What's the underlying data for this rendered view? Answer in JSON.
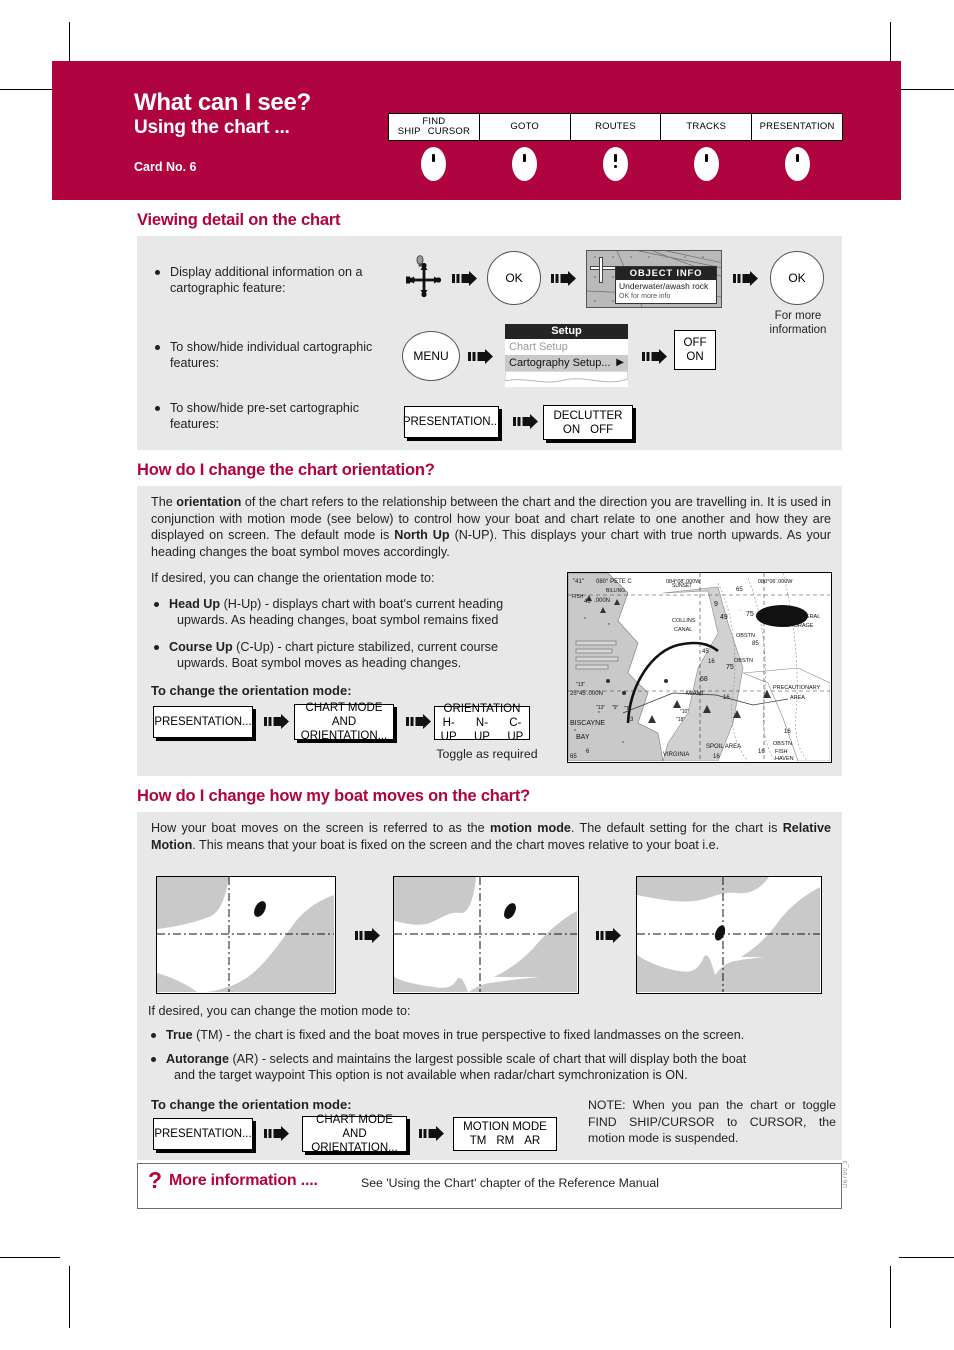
{
  "header": {
    "title": "What can I see?",
    "subtitle": "Using the chart ...",
    "card_no": "Card No. 6",
    "brand_color": "#b00440",
    "softkeys": [
      {
        "line1": "FIND",
        "line2a": "SHIP",
        "line2b": "CURSOR",
        "dotted": false
      },
      {
        "line1": "GOTO",
        "line2a": "",
        "line2b": "",
        "dotted": false
      },
      {
        "line1": "ROUTES",
        "line2a": "",
        "line2b": "",
        "dotted": true
      },
      {
        "line1": "TRACKS",
        "line2a": "",
        "line2b": "",
        "dotted": false
      },
      {
        "line1": "PRESENTATION",
        "line2a": "",
        "line2b": "",
        "dotted": false
      }
    ]
  },
  "section1": {
    "heading": "Viewing detail on the chart",
    "rows": [
      {
        "text_l1": "Display additional information on a",
        "text_l2": "cartographic feature:"
      },
      {
        "text_l1": "To show/hide individual cartographic",
        "text_l2": "features:"
      },
      {
        "text_l1": "To show/hide pre-set cartographic",
        "text_l2": "features:"
      }
    ],
    "ok_key": "OK",
    "ok_key2": "OK",
    "ok_caption_l1": "For more",
    "ok_caption_l2": "information",
    "menu_key": "MENU",
    "object_info": {
      "title": "OBJECT INFO",
      "line1": "Underwater/awash rock",
      "line2": "OK for more info"
    },
    "setup_menu": {
      "title": "Setup",
      "item1": "Chart Setup",
      "item2": "Cartography Setup...",
      "arrow_glyph": "▶"
    },
    "onoff_box": {
      "opt1": "OFF",
      "opt2": "ON"
    },
    "presentation_box": {
      "label": "PRESENTATION..."
    },
    "declutter_box": {
      "label": "DECLUTTER",
      "opt1": "ON",
      "opt2": "OFF"
    }
  },
  "section2": {
    "heading": "How do I change the chart orientation?",
    "para1_a": "The ",
    "para1_b": "orientation",
    "para1_c": " of the chart refers to the relationship between the chart and the direction you are travelling in.  It is used in conjunction with motion mode (see below) to control how your boat and chart relate to one another and how they are displayed on screen.  The default mode is ",
    "para1_d": "North Up",
    "para1_e": " (N-UP).  This displays your chart with true north upwards.  As your heading changes the boat symbol moves accordingly.",
    "para2": "If desired, you can change the orientation mode to:",
    "bullets": [
      {
        "bold": "Head Up",
        "rest_l1": " (H-Up) - displays chart with boat's current heading",
        "rest_l2": "upwards.  As heading changes, boat symbol remains fixed"
      },
      {
        "bold": "Course Up",
        "rest_l1": " (C-Up) - chart picture stabilized, current course",
        "rest_l2": "upwards.  Boat symbol moves as heading changes."
      }
    ],
    "subhead": "To change the orientation mode:",
    "steps": [
      {
        "label": "PRESENTATION..."
      },
      {
        "label_l1": "CHART MODE AND",
        "label_l2": "ORIENTATION..."
      },
      {
        "label": "ORIENTATION",
        "opts": [
          "H-UP",
          "N-UP",
          "C-UP"
        ]
      }
    ],
    "toggle_caption": "Toggle as required",
    "chart_labels": [
      "\"41\"",
      "080° PETE C",
      "084°08'.000W",
      "080°06'.000W",
      "BILLING",
      "SUNSET",
      "65",
      "9",
      "49",
      "75",
      "COLLINS",
      "CANAL",
      "OBSTN",
      "85",
      "45",
      "16",
      "OBSTN",
      "75",
      "68",
      "GENERAL",
      "ANCHORAGE",
      "PRECAUTIONARY",
      "AREA",
      "25°45'.000N",
      "MIAMI",
      "16",
      "13",
      "10",
      "18",
      "3",
      "BISCAYNE",
      "BAY",
      "VIRGINIA",
      "SPOIL AREA",
      "16",
      "OBSTN",
      "FISH",
      "HAVEN",
      "65",
      "6"
    ]
  },
  "section3": {
    "heading": "How do I change how my boat moves on the chart?",
    "para1_a": "How your boat moves on the screen is referred to as the ",
    "para1_b": "motion mode",
    "para1_c": ".  The default setting for the chart is ",
    "para1_d": "Relative Motion",
    "para1_e": ".  This means that your boat is fixed on the screen and the chart moves relative to your boat i.e.",
    "para2": "If desired, you can change the motion mode to:",
    "bullets": [
      {
        "bold": "True",
        "rest_l1": " (TM) - the chart is fixed and the boat moves in true perspective to fixed landmasses on the screen.",
        "rest_l2": ""
      },
      {
        "bold": "Autorange",
        "rest_l1": " (AR) - selects and maintains the largest possible scale of chart that will display both the boat",
        "rest_l2": "and the target waypoint  This option is not available when radar/chart symchronization is ON."
      }
    ],
    "subhead": "To change the orientation mode:",
    "steps": [
      {
        "label": "PRESENTATION..."
      },
      {
        "label_l1": "CHART MODE AND",
        "label_l2": "ORIENTATION..."
      },
      {
        "label": "MOTION MODE",
        "opts": [
          "TM",
          "RM",
          "AR"
        ]
      }
    ],
    "note": "NOTE:   When you pan the chart or toggle FIND SHIP/CURSOR to CURSOR, the motion mode is suspended."
  },
  "footer": {
    "q_glyph": "?",
    "more_info": "More information ....",
    "reference": "See 'Using the Chart' chapter of the Reference Manual",
    "doc_code": "D6790_3"
  }
}
